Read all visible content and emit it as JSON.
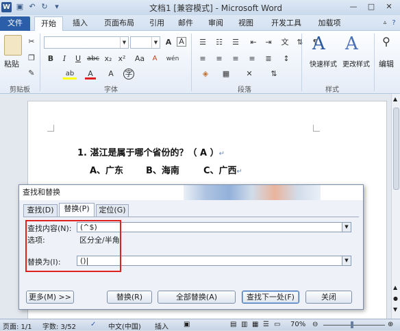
{
  "window": {
    "title": "文档1 [兼容模式] - Microsoft Word",
    "app_icon": "W"
  },
  "quick_access": [
    "save-icon",
    "undo-icon",
    "redo-icon",
    "customize-icon"
  ],
  "tabs": [
    {
      "label": "文件"
    },
    {
      "label": "开始"
    },
    {
      "label": "插入"
    },
    {
      "label": "页面布局"
    },
    {
      "label": "引用"
    },
    {
      "label": "邮件"
    },
    {
      "label": "审阅"
    },
    {
      "label": "视图"
    },
    {
      "label": "开发工具"
    },
    {
      "label": "加载项"
    }
  ],
  "ribbon": {
    "clipboard": {
      "paste_label": "粘贴",
      "group_label": "剪贴板"
    },
    "font": {
      "group_label": "字体",
      "bold": "B",
      "italic": "I",
      "underline": "U",
      "strike": "abc",
      "sub": "x₂",
      "sup": "x²",
      "grow": "A",
      "shrink": "A",
      "clear": "A",
      "highlight": "ab",
      "color": "A",
      "case": "Aa",
      "phonetic": "wén",
      "border": "A"
    },
    "paragraph": {
      "group_label": "段落"
    },
    "styles": {
      "quick_styles_label": "快速样式",
      "change_styles_label": "更改样式",
      "group_label": "样式"
    },
    "editing": {
      "label": "编辑"
    }
  },
  "document": {
    "question": "1. 湛江是属于哪个省份的？（ A ）",
    "options": [
      "A、广东",
      "B、海南",
      "C、广西"
    ],
    "para_mark": "↵"
  },
  "dialog": {
    "title": "查找和替换",
    "tabs": [
      "查找(D)",
      "替换(P)",
      "定位(G)"
    ],
    "find_label": "查找内容(N):",
    "find_value": "(^$)",
    "options_label": "选项:",
    "options_value": "区分全/半角",
    "replace_label": "替换为(I):",
    "replace_value": "()|",
    "buttons": {
      "more": "更多(M) >>",
      "replace": "替换(R)",
      "replace_all": "全部替换(A)",
      "find_next": "查找下一处(F)",
      "close": "关闭"
    }
  },
  "status": {
    "page": "页面: 1/1",
    "words": "字数: 3/52",
    "language": "中文(中国)",
    "mode": "插入",
    "zoom": "70%"
  }
}
